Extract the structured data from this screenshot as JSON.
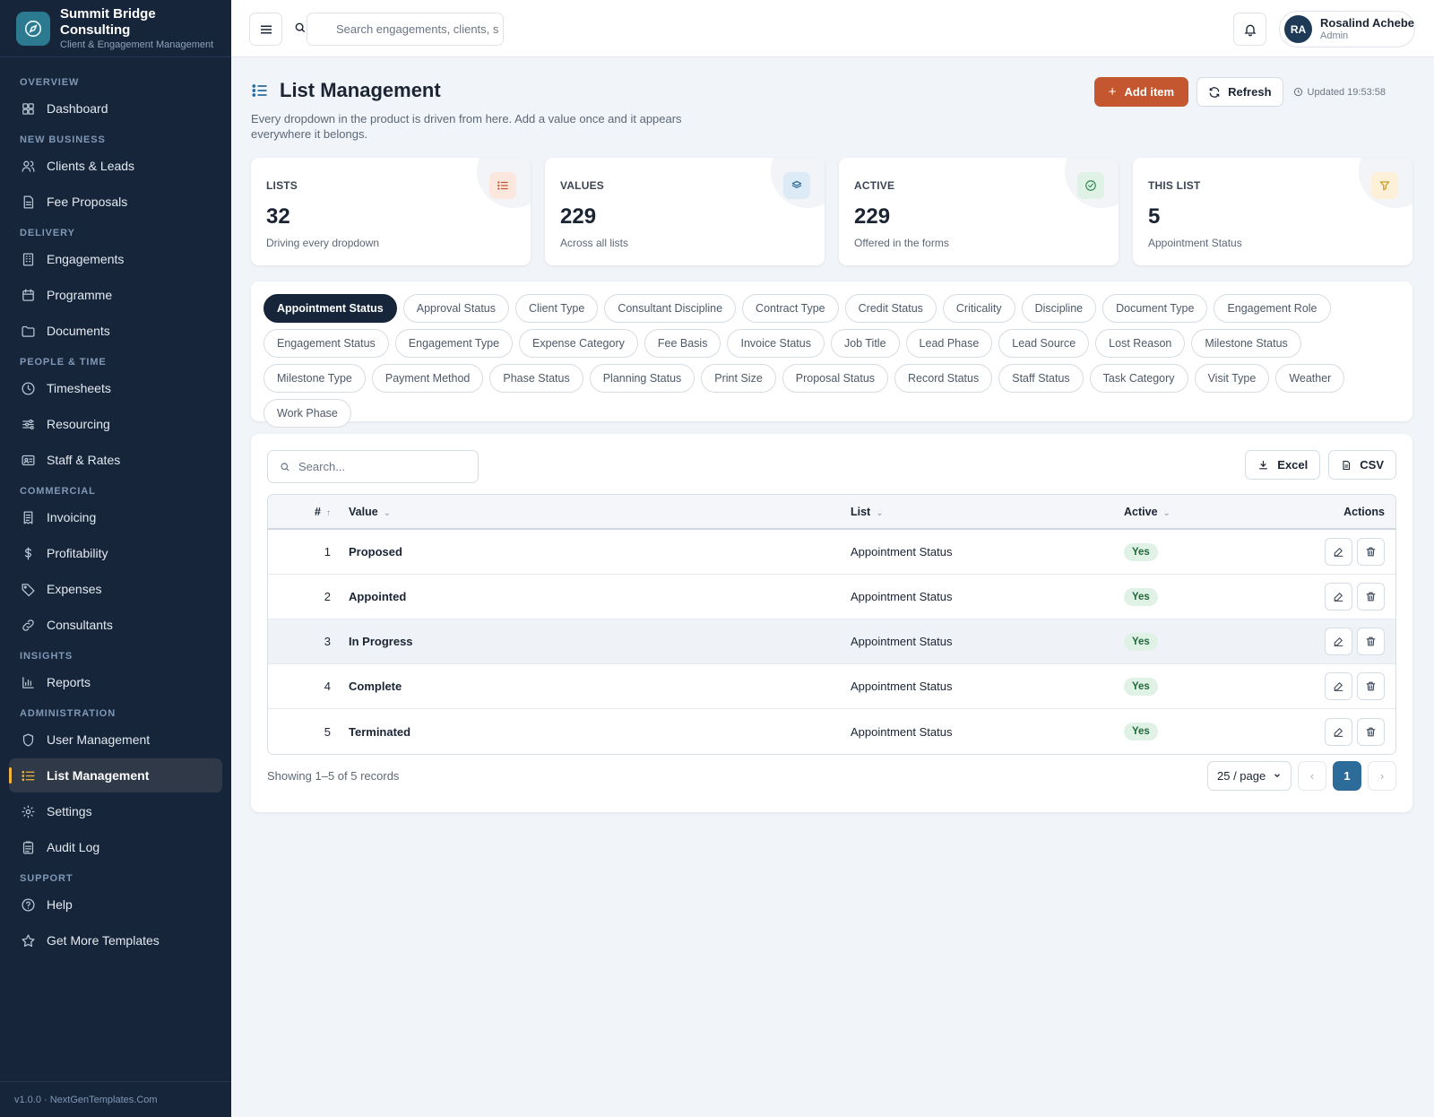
{
  "brand": {
    "name": "Summit Bridge Consulting",
    "subtitle": "Client & Engagement Management"
  },
  "sidebar": {
    "sections": [
      {
        "title": "OVERVIEW",
        "items": [
          {
            "label": "Dashboard",
            "icon": "dashboard-icon"
          }
        ]
      },
      {
        "title": "NEW BUSINESS",
        "items": [
          {
            "label": "Clients & Leads",
            "icon": "users-icon"
          },
          {
            "label": "Fee Proposals",
            "icon": "document-icon"
          }
        ]
      },
      {
        "title": "DELIVERY",
        "items": [
          {
            "label": "Engagements",
            "icon": "building-icon"
          },
          {
            "label": "Programme",
            "icon": "calendar-icon"
          },
          {
            "label": "Documents",
            "icon": "folder-icon"
          }
        ]
      },
      {
        "title": "PEOPLE & TIME",
        "items": [
          {
            "label": "Timesheets",
            "icon": "clock-icon"
          },
          {
            "label": "Resourcing",
            "icon": "sliders-icon"
          },
          {
            "label": "Staff & Rates",
            "icon": "id-card-icon"
          }
        ]
      },
      {
        "title": "COMMERCIAL",
        "items": [
          {
            "label": "Invoicing",
            "icon": "receipt-icon"
          },
          {
            "label": "Profitability",
            "icon": "dollar-icon"
          },
          {
            "label": "Expenses",
            "icon": "tag-icon"
          },
          {
            "label": "Consultants",
            "icon": "link-icon"
          }
        ]
      },
      {
        "title": "INSIGHTS",
        "items": [
          {
            "label": "Reports",
            "icon": "bar-chart-icon"
          }
        ]
      },
      {
        "title": "ADMINISTRATION",
        "items": [
          {
            "label": "User Management",
            "icon": "shield-icon"
          },
          {
            "label": "List Management",
            "icon": "list-icon",
            "active": true
          },
          {
            "label": "Settings",
            "icon": "gear-icon"
          },
          {
            "label": "Audit Log",
            "icon": "clipboard-icon"
          }
        ]
      },
      {
        "title": "SUPPORT",
        "items": [
          {
            "label": "Help",
            "icon": "help-icon"
          },
          {
            "label": "Get More Templates",
            "icon": "star-icon"
          }
        ]
      }
    ],
    "footer": "v1.0.0 · NextGenTemplates.Com"
  },
  "topbar": {
    "search_placeholder": "Search engagements, clients, s",
    "user": {
      "initials": "RA",
      "name": "Rosalind Achebe",
      "role": "Admin"
    }
  },
  "page": {
    "title": "List Management",
    "description": "Every dropdown in the product is driven from here. Add a value once and it appears everywhere it belongs.",
    "add_label": "Add item",
    "refresh_label": "Refresh",
    "updated": "Updated 19:53:58"
  },
  "stats": [
    {
      "label": "LISTS",
      "value": "32",
      "sub": "Driving every dropdown",
      "icon": "list-icon",
      "color": "#c4572f",
      "bg": "#fbe7de"
    },
    {
      "label": "VALUES",
      "value": "229",
      "sub": "Across all lists",
      "icon": "layers-icon",
      "color": "#2d6b9a",
      "bg": "#dcebf6"
    },
    {
      "label": "ACTIVE",
      "value": "229",
      "sub": "Offered in the forms",
      "icon": "check-circle-icon",
      "color": "#2e8a52",
      "bg": "#dff2e5"
    },
    {
      "label": "THIS LIST",
      "value": "5",
      "sub": "Appointment Status",
      "icon": "filter-icon",
      "color": "#c99416",
      "bg": "#fcf1d8"
    }
  ],
  "lists": [
    "Appointment Status",
    "Approval Status",
    "Client Type",
    "Consultant Discipline",
    "Contract Type",
    "Credit Status",
    "Criticality",
    "Discipline",
    "Document Type",
    "Engagement Role",
    "Engagement Status",
    "Engagement Type",
    "Expense Category",
    "Fee Basis",
    "Invoice Status",
    "Job Title",
    "Lead Phase",
    "Lead Source",
    "Lost Reason",
    "Milestone Status",
    "Milestone Type",
    "Payment Method",
    "Phase Status",
    "Planning Status",
    "Print Size",
    "Proposal Status",
    "Record Status",
    "Staff Status",
    "Task Category",
    "Visit Type",
    "Weather",
    "Work Phase"
  ],
  "active_list": "Appointment Status",
  "table": {
    "search_placeholder": "Search...",
    "excel_label": "Excel",
    "csv_label": "CSV",
    "columns": {
      "num": "#",
      "value": "Value",
      "list": "List",
      "active": "Active",
      "actions": "Actions"
    },
    "rows": [
      {
        "num": "1",
        "value": "Proposed",
        "list": "Appointment Status",
        "active": "Yes"
      },
      {
        "num": "2",
        "value": "Appointed",
        "list": "Appointment Status",
        "active": "Yes"
      },
      {
        "num": "3",
        "value": "In Progress",
        "list": "Appointment Status",
        "active": "Yes"
      },
      {
        "num": "4",
        "value": "Complete",
        "list": "Appointment Status",
        "active": "Yes"
      },
      {
        "num": "5",
        "value": "Terminated",
        "list": "Appointment Status",
        "active": "Yes"
      }
    ],
    "showing": "Showing 1–5 of 5 records",
    "per_page": "25 / page",
    "current_page": "1",
    "prev": "‹",
    "next": "›"
  }
}
